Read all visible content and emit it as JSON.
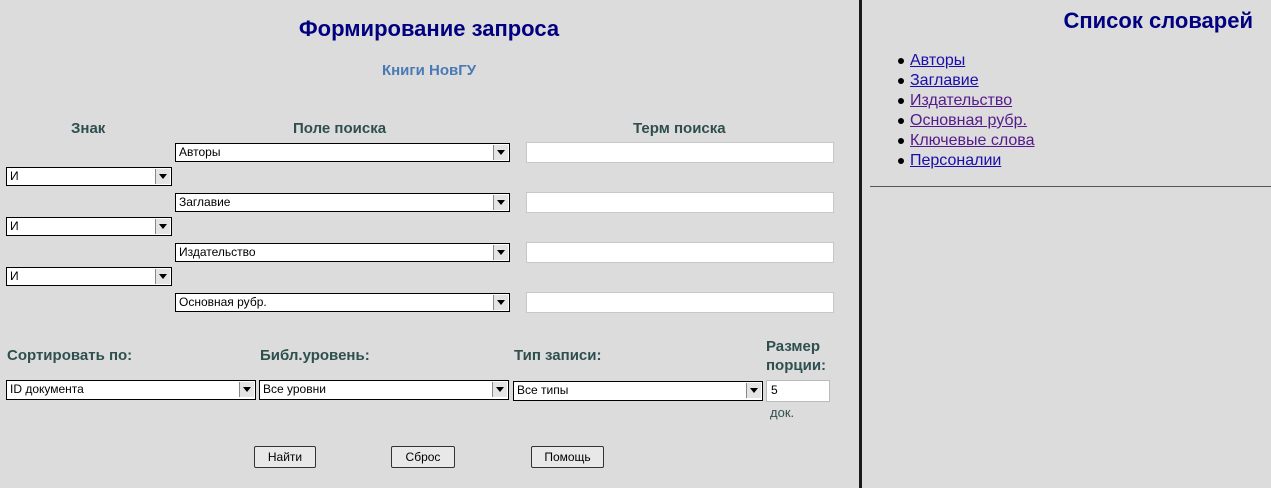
{
  "form": {
    "title": "Формирование запроса",
    "subtitle": "Книги НовГУ",
    "headers": {
      "sign": "Знак",
      "field": "Поле поиска",
      "term": "Терм поиска"
    },
    "rows": [
      {
        "field": "Авторы",
        "term": ""
      },
      {
        "operator": "И",
        "field": "Заглавие",
        "term": ""
      },
      {
        "operator": "И",
        "field": "Издательство",
        "term": ""
      },
      {
        "operator": "И",
        "field": "Основная рубр.",
        "term": ""
      }
    ],
    "sort": {
      "label": "Сортировать по:",
      "value": "ID документа"
    },
    "level": {
      "label": "Библ.уровень:",
      "value": "Все уровни"
    },
    "record_type": {
      "label": "Тип записи:",
      "value": "Все типы"
    },
    "portion": {
      "label_line1": "Размер",
      "label_line2": "порции:",
      "value": "5",
      "unit": "док."
    },
    "buttons": {
      "find": "Найти",
      "reset": "Сброс",
      "help": "Помощь"
    }
  },
  "dictionaries": {
    "title": "Список словарей",
    "items": [
      {
        "label": "Авторы",
        "visited": false
      },
      {
        "label": "Заглавие",
        "visited": false
      },
      {
        "label": "Издательство",
        "visited": true
      },
      {
        "label": "Основная рубр.",
        "visited": true
      },
      {
        "label": "Ключевые слова",
        "visited": true
      },
      {
        "label": "Персоналии",
        "visited": false
      }
    ]
  },
  "colors": {
    "background": "#dcdcdc",
    "title": "#000080",
    "subtitle": "#4a7ab5",
    "label": "#2f4f4f"
  }
}
